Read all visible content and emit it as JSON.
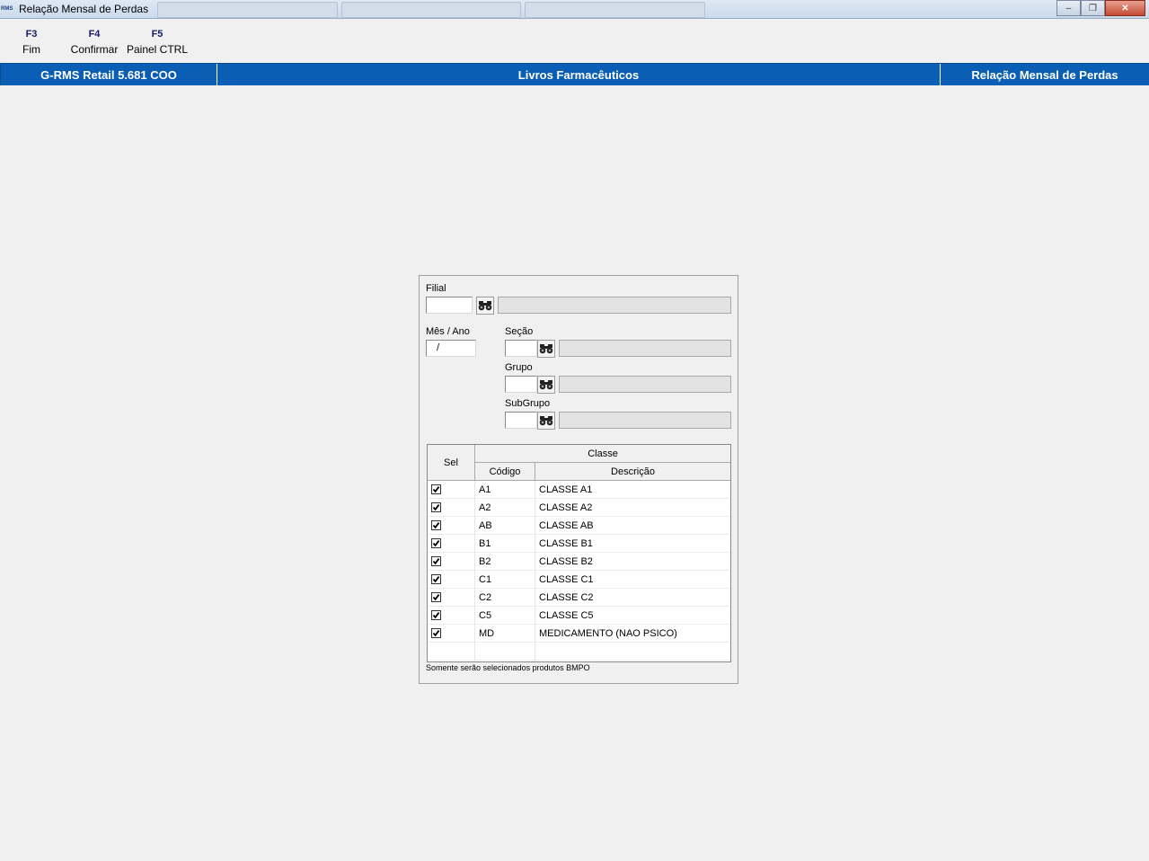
{
  "window": {
    "app_icon_text": "RMS",
    "title": "Relação Mensal de Perdas",
    "minimize": "–",
    "maximize": "❐",
    "close": "✕"
  },
  "function_keys": [
    {
      "key": "F3",
      "label": "Fim"
    },
    {
      "key": "F4",
      "label": "Confirmar"
    },
    {
      "key": "F5",
      "label": "Painel CTRL"
    }
  ],
  "header": {
    "system": "G-RMS Retail 5.681 COO",
    "module": "Livros Farmacêuticos",
    "screen": "Relação Mensal de Perdas"
  },
  "form": {
    "filial_label": "Filial",
    "filial_value": "",
    "mes_ano_label": "Mês / Ano",
    "mes_ano_value": "/",
    "secao_label": "Seção",
    "secao_value": "",
    "grupo_label": "Grupo",
    "grupo_value": "",
    "subgrupo_label": "SubGrupo",
    "subgrupo_value": ""
  },
  "grid": {
    "col_sel": "Sel",
    "col_group": "Classe",
    "col_codigo": "Código",
    "col_descricao": "Descrição",
    "rows": [
      {
        "checked": true,
        "codigo": "A1",
        "descricao": "CLASSE A1"
      },
      {
        "checked": true,
        "codigo": "A2",
        "descricao": "CLASSE A2"
      },
      {
        "checked": true,
        "codigo": "AB",
        "descricao": "CLASSE AB"
      },
      {
        "checked": true,
        "codigo": "B1",
        "descricao": "CLASSE B1"
      },
      {
        "checked": true,
        "codigo": "B2",
        "descricao": "CLASSE B2"
      },
      {
        "checked": true,
        "codigo": "C1",
        "descricao": "CLASSE C1"
      },
      {
        "checked": true,
        "codigo": "C2",
        "descricao": "CLASSE C2"
      },
      {
        "checked": true,
        "codigo": "C5",
        "descricao": "CLASSE C5"
      },
      {
        "checked": true,
        "codigo": "MD",
        "descricao": "MEDICAMENTO (NAO PSICO)"
      }
    ]
  },
  "note": "Somente serão selecionados produtos BMPO",
  "colors": {
    "header_blue": "#0a5fb5",
    "window_bg": "#f0f0f0"
  }
}
